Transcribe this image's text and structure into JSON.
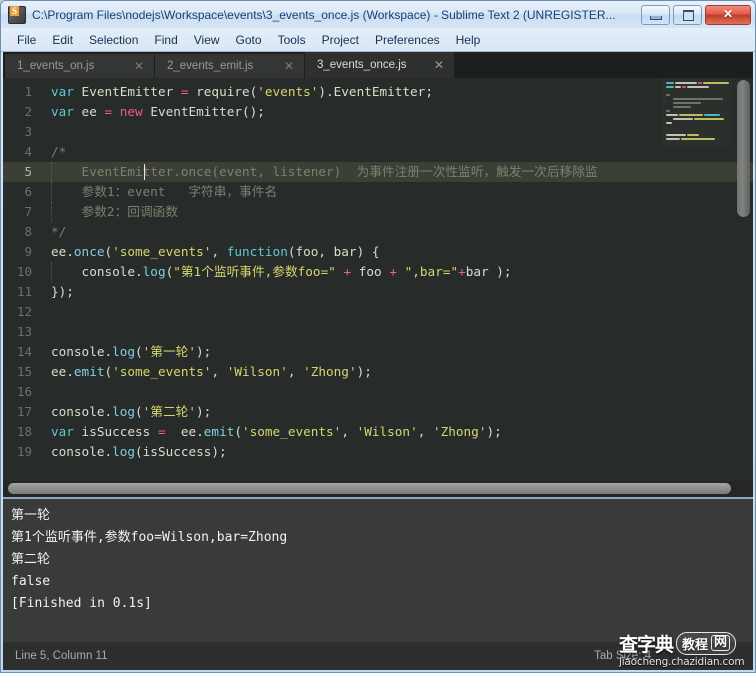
{
  "window": {
    "title": "C:\\Program Files\\nodejs\\Workspace\\events\\3_events_once.js (Workspace) - Sublime Text 2 (UNREGISTER...",
    "icon": "sublime-text-icon",
    "controls": {
      "minimize": "minimize-icon",
      "maximize": "maximize-icon",
      "close": "✕"
    }
  },
  "menubar": {
    "items": [
      {
        "label": "File"
      },
      {
        "label": "Edit"
      },
      {
        "label": "Selection"
      },
      {
        "label": "Find"
      },
      {
        "label": "View"
      },
      {
        "label": "Goto"
      },
      {
        "label": "Tools"
      },
      {
        "label": "Project"
      },
      {
        "label": "Preferences"
      },
      {
        "label": "Help"
      }
    ]
  },
  "tabs": [
    {
      "label": "1_events_on.js",
      "close": "✕",
      "active": false
    },
    {
      "label": "2_events_emit.js",
      "close": "✕",
      "active": false
    },
    {
      "label": "3_events_once.js",
      "close": "✕",
      "active": true
    }
  ],
  "editor": {
    "line_numbers": [
      "1",
      "2",
      "3",
      "4",
      "5",
      "6",
      "7",
      "8",
      "9",
      "10",
      "11",
      "12",
      "13",
      "14",
      "15",
      "16",
      "17",
      "18",
      "19"
    ],
    "current_line": 5,
    "lines": [
      {
        "n": "1",
        "text": "var EventEmitter = require('events').EventEmitter;"
      },
      {
        "n": "2",
        "text": "var ee = new EventEmitter();"
      },
      {
        "n": "3",
        "text": ""
      },
      {
        "n": "4",
        "text": "/*"
      },
      {
        "n": "5",
        "text": "    EventEmitter.once(event, listener)  为事件注册一次性监听，触发一次后移除监"
      },
      {
        "n": "6",
        "text": "    参数1：event   字符串，事件名"
      },
      {
        "n": "7",
        "text": "    参数2：回调函数"
      },
      {
        "n": "8",
        "text": "*/"
      },
      {
        "n": "9",
        "text": "ee.once('some_events', function(foo, bar) {"
      },
      {
        "n": "10",
        "text": "    console.log(\"第1个监听事件,参数foo=\" + foo + \",bar=\"+bar );"
      },
      {
        "n": "11",
        "text": "});"
      },
      {
        "n": "12",
        "text": ""
      },
      {
        "n": "13",
        "text": ""
      },
      {
        "n": "14",
        "text": "console.log('第一轮');"
      },
      {
        "n": "15",
        "text": "ee.emit('some_events', 'Wilson', 'Zhong');"
      },
      {
        "n": "16",
        "text": ""
      },
      {
        "n": "17",
        "text": "console.log('第二轮');"
      },
      {
        "n": "18",
        "text": "var isSuccess =  ee.emit('some_events', 'Wilson', 'Zhong');"
      },
      {
        "n": "19",
        "text": "console.log(isSuccess);"
      }
    ]
  },
  "output": {
    "lines": [
      "第一轮",
      "第1个监听事件,参数foo=Wilson,bar=Zhong",
      "第二轮",
      "false",
      "[Finished in 0.1s]"
    ]
  },
  "statusbar": {
    "position": "Line 5, Column 11",
    "tab_size": "Tab Size: 4"
  },
  "watermark": {
    "text1": "查字典",
    "text2": "教程",
    "text3": "网",
    "url": "jiaocheng.chazidian.com"
  },
  "colors": {
    "editor_bg": "#272b29",
    "gutter_text": "#6b716b",
    "current_line_bg": "#3b3f35",
    "keyword": "#5fc9d6",
    "operator": "#f05a8c",
    "string": "#d6d66c",
    "comment": "#7c8071",
    "plain": "#dcdccc",
    "output_bg": "#383b3a",
    "titlebar_text": "#15407a",
    "close_button": "#c23a27"
  }
}
